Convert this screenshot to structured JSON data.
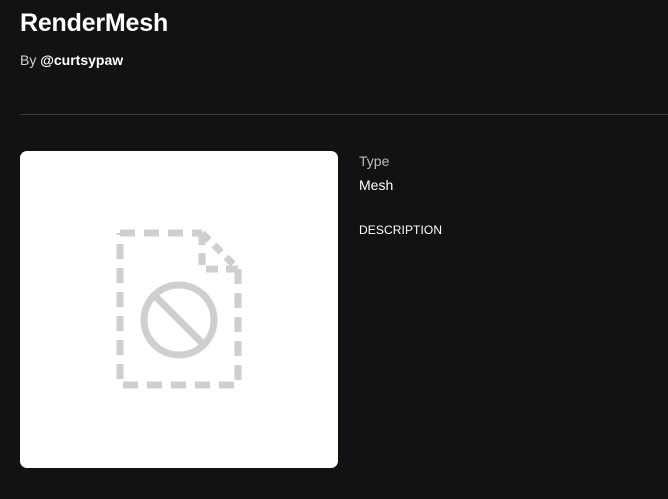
{
  "asset": {
    "title": "RenderMesh",
    "by_prefix": "By ",
    "creator": "@curtsypaw"
  },
  "thumbnail": {
    "icon": "unavailable-file-icon"
  },
  "details": {
    "type_label": "Type",
    "type_value": "Mesh",
    "description_heading": "DESCRIPTION"
  },
  "colors": {
    "background": "#121215",
    "divider": "#393b3d",
    "thumbnail_bg": "#ffffff",
    "icon_gray": "#cfcfcf"
  }
}
